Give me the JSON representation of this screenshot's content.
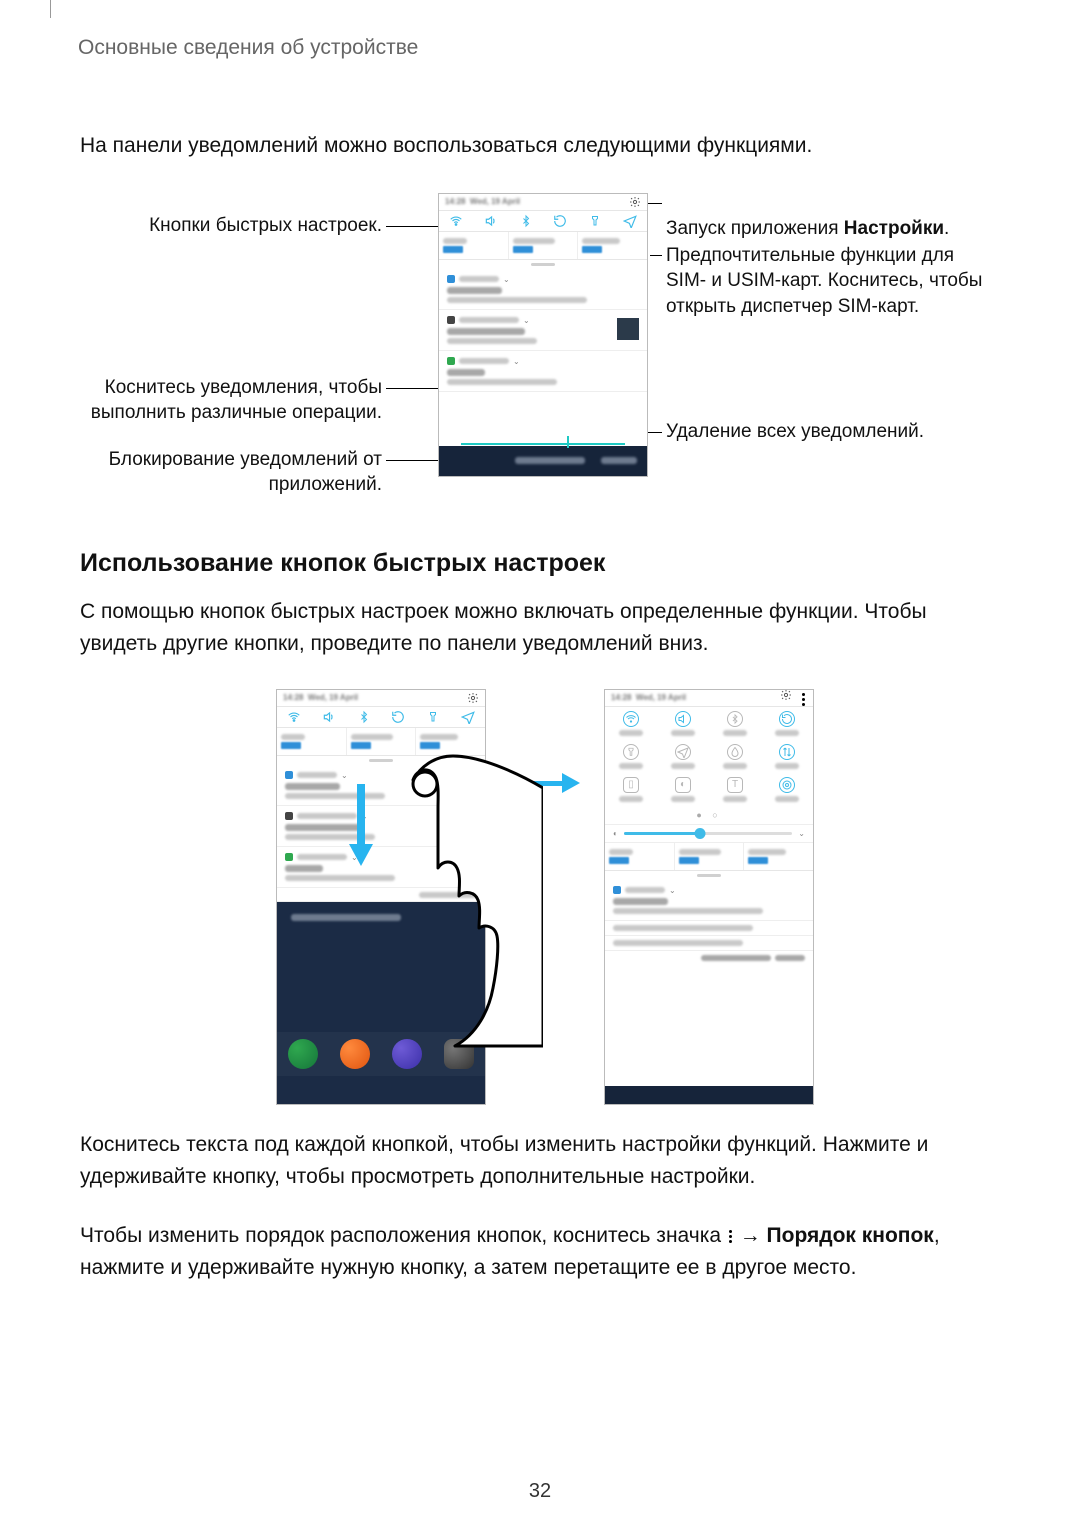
{
  "header": {
    "running_head": "Основные сведения об устройстве"
  },
  "intro_text": "На панели уведомлений можно воспользоваться следующими функциями.",
  "callouts": {
    "left1": "Кнопки быстрых настроек.",
    "left2": "Коснитесь уведомления, чтобы\nвыполнить различные операции.",
    "left3": "Блокирование уведомлений от\nприложений.",
    "right1_pre": "Запуск приложения ",
    "right1_bold": "Настройки",
    "right1_post": ".",
    "right2": "Предпочтительные функции для\nSIM- и USIM-карт. Коснитесь, чтобы\nоткрыть диспетчер SIM-карт.",
    "right3": "Удаление всех уведомлений."
  },
  "section": {
    "title": "Использование кнопок быстрых настроек",
    "para1": "С помощью кнопок быстрых настроек можно включать определенные функции. Чтобы увидеть другие кнопки, проведите по панели уведомлений вниз.",
    "para2": "Коснитесь текста под каждой кнопкой, чтобы изменить настройки функций. Нажмите и удерживайте кнопку, чтобы просмотреть дополнительные настройки.",
    "para3_pre": "Чтобы изменить порядок расположения кнопок, коснитесь значка ",
    "para3_arrow": " → ",
    "para3_bold": "Порядок кнопок",
    "para3_post": ", нажмите и удерживайте нужную кнопку, а затем перетащите ее в другое место."
  },
  "page_number": "32"
}
